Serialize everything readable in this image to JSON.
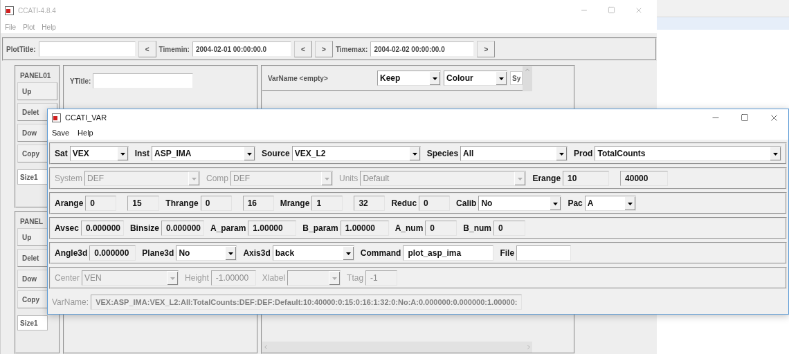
{
  "background_window": {
    "title": "CCATI-4.8.4",
    "menu": [
      "File",
      "Plot",
      "Help"
    ],
    "toolbar": [
      {
        "kind": "label",
        "text": "PlotTitle:"
      },
      {
        "kind": "field"
      },
      {
        "kind": "button",
        "text": "<"
      },
      {
        "kind": "label",
        "text": "Timemin:"
      },
      {
        "kind": "field",
        "value": "2004-02-01 00:00:00.0"
      },
      {
        "kind": "button",
        "text": "<"
      },
      {
        "kind": "button",
        "text": ">"
      },
      {
        "kind": "label",
        "text": "Timemax:"
      },
      {
        "kind": "field",
        "value": "2004-02-02 00:00:00.0"
      },
      {
        "kind": "button",
        "text": ">"
      }
    ],
    "panels": [
      {
        "title": "PANEL01",
        "buttons": [
          "Up",
          "Delet",
          "Dow",
          "Copy"
        ],
        "size": "Size1"
      },
      {
        "title": "PANEL",
        "buttons": [
          "Up",
          "Delet",
          "Dow",
          "Copy"
        ],
        "size": "Size1"
      }
    ],
    "ytitle_label": "YTitle:",
    "var_panel": {
      "title": "VarName <empty>",
      "dropdowns": [
        "Keep",
        "Colour"
      ],
      "cut_dropdown": "Sy"
    }
  },
  "var_window": {
    "title": "CCATI_VAR",
    "menu": [
      "Save",
      "Help"
    ],
    "rows": [
      {
        "disabled": false,
        "items": [
          {
            "kind": "label",
            "text": "Sat"
          },
          {
            "kind": "dropdown",
            "value": "VEX"
          },
          {
            "kind": "label",
            "text": "Inst"
          },
          {
            "kind": "dropdown",
            "value": "ASP_IMA"
          },
          {
            "kind": "label",
            "text": "Source"
          },
          {
            "kind": "dropdown",
            "value": "VEX_L2"
          },
          {
            "kind": "label",
            "text": "Species"
          },
          {
            "kind": "dropdown",
            "value": "All"
          },
          {
            "kind": "label",
            "text": "Prod"
          },
          {
            "kind": "dropdown",
            "value": "TotalCounts"
          }
        ]
      },
      {
        "disabled": true,
        "items": [
          {
            "kind": "label",
            "text": "System"
          },
          {
            "kind": "dropdown",
            "value": "DEF"
          },
          {
            "kind": "label",
            "text": "Comp"
          },
          {
            "kind": "dropdown",
            "value": "DEF"
          },
          {
            "kind": "label",
            "text": "Units"
          },
          {
            "kind": "dropdown",
            "value": "Default"
          },
          {
            "kind": "label",
            "text": "Erange",
            "enabled": true
          },
          {
            "kind": "field",
            "value": "10",
            "readonly": true,
            "enabled": true
          },
          {
            "kind": "field",
            "value": "40000",
            "readonly": true,
            "enabled": true
          }
        ]
      },
      {
        "disabled": false,
        "items": [
          {
            "kind": "label",
            "text": "Arange"
          },
          {
            "kind": "field",
            "value": "0",
            "readonly": true
          },
          {
            "kind": "field",
            "value": "15",
            "readonly": true
          },
          {
            "kind": "label",
            "text": "Thrange"
          },
          {
            "kind": "field",
            "value": "0",
            "readonly": true
          },
          {
            "kind": "field",
            "value": "16",
            "readonly": true
          },
          {
            "kind": "label",
            "text": "Mrange"
          },
          {
            "kind": "field",
            "value": "1",
            "readonly": true
          },
          {
            "kind": "field",
            "value": "32",
            "readonly": true
          },
          {
            "kind": "label",
            "text": "Reduc"
          },
          {
            "kind": "field",
            "value": "0",
            "readonly": true
          },
          {
            "kind": "label",
            "text": "Calib"
          },
          {
            "kind": "dropdown",
            "value": "No"
          },
          {
            "kind": "label",
            "text": "Pac"
          },
          {
            "kind": "dropdown",
            "value": "A"
          }
        ]
      },
      {
        "disabled": false,
        "items": [
          {
            "kind": "label",
            "text": "Avsec"
          },
          {
            "kind": "field",
            "value": "0.000000",
            "readonly": true
          },
          {
            "kind": "label",
            "text": "Binsize"
          },
          {
            "kind": "field",
            "value": "0.000000",
            "readonly": true
          },
          {
            "kind": "label",
            "text": "A_param"
          },
          {
            "kind": "field",
            "value": "1.00000",
            "readonly": true
          },
          {
            "kind": "label",
            "text": "B_param"
          },
          {
            "kind": "field",
            "value": "1.00000",
            "readonly": true
          },
          {
            "kind": "label",
            "text": "A_num"
          },
          {
            "kind": "field",
            "value": "0",
            "readonly": true
          },
          {
            "kind": "label",
            "text": "B_num"
          },
          {
            "kind": "field",
            "value": "0",
            "readonly": true
          }
        ]
      },
      {
        "disabled": false,
        "items": [
          {
            "kind": "label",
            "text": "Angle3d"
          },
          {
            "kind": "field",
            "value": "0.000000",
            "readonly": true
          },
          {
            "kind": "label",
            "text": "Plane3d"
          },
          {
            "kind": "dropdown",
            "value": "No"
          },
          {
            "kind": "label",
            "text": "Axis3d"
          },
          {
            "kind": "dropdown",
            "value": "back"
          },
          {
            "kind": "label",
            "text": "Command"
          },
          {
            "kind": "field",
            "value": "plot_asp_ima",
            "readonly": false
          },
          {
            "kind": "label",
            "text": "File"
          },
          {
            "kind": "field",
            "readonly": false
          }
        ]
      },
      {
        "disabled": true,
        "items": [
          {
            "kind": "label",
            "text": "Center"
          },
          {
            "kind": "dropdown",
            "value": "VEN"
          },
          {
            "kind": "label",
            "text": "Height"
          },
          {
            "kind": "field",
            "value": "-1.00000",
            "readonly": true
          },
          {
            "kind": "label",
            "text": "Xlabel"
          },
          {
            "kind": "dropdown"
          },
          {
            "kind": "label",
            "text": "Ttag"
          },
          {
            "kind": "field",
            "value": "-1",
            "readonly": true
          }
        ]
      }
    ],
    "varname": {
      "label": "VarName:",
      "value": "VEX:ASP_IMA:VEX_L2:All:TotalCounts:DEF:DEF:Default:10:40000:0:15:0:16:1:32:0:No:A:0.000000:0.000000:1.00000:",
      "disabled": true
    }
  }
}
